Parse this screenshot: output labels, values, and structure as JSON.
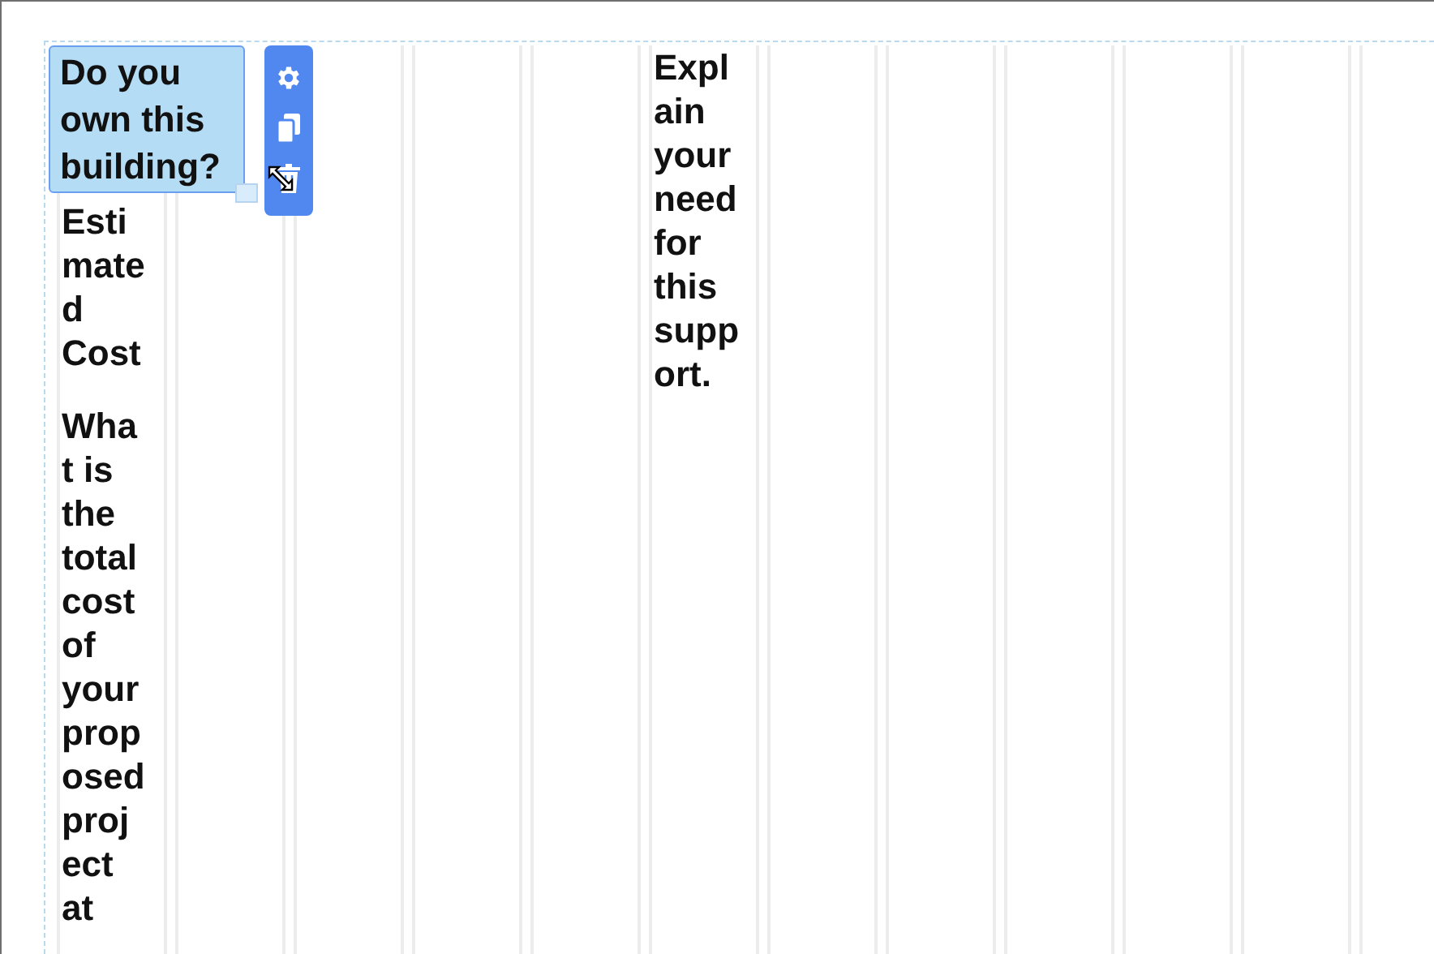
{
  "selected_field": {
    "label": "Do you own this building?",
    "selected": true
  },
  "column_1": [
    {
      "label": "Estimated Cost"
    },
    {
      "label": "What is the total cost of your proposed project at"
    }
  ],
  "column_6": [
    {
      "label": "Explain your need for this support."
    }
  ]
}
